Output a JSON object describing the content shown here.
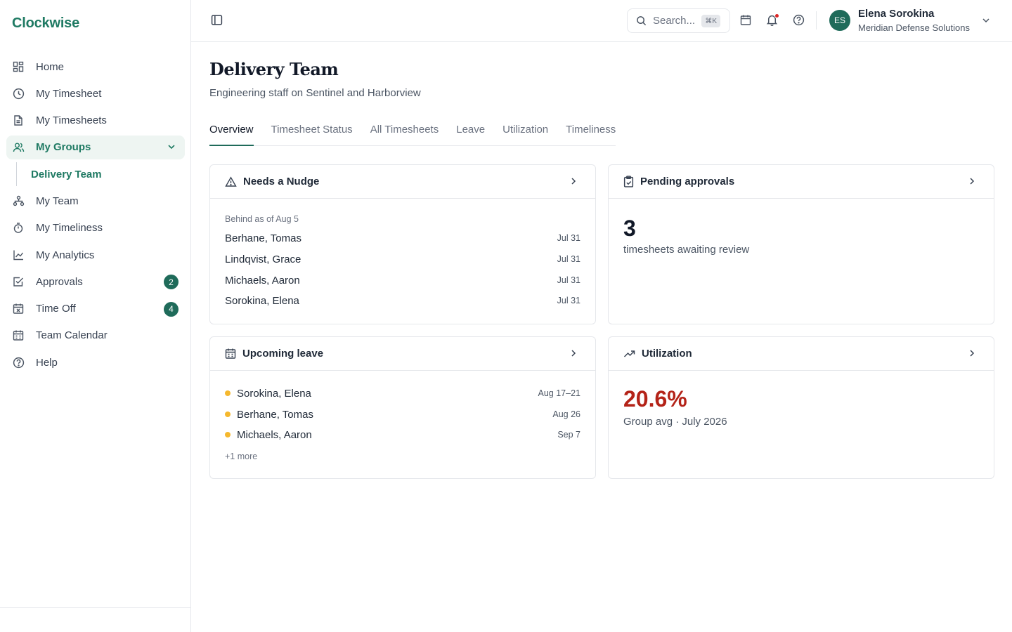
{
  "app": {
    "name": "Clockwise"
  },
  "sidebar": {
    "items": [
      {
        "label": "Home",
        "icon": "grid-icon"
      },
      {
        "label": "My Timesheet",
        "icon": "clock-icon"
      },
      {
        "label": "My Timesheets",
        "icon": "document-icon"
      },
      {
        "label": "My Groups",
        "icon": "users-icon"
      },
      {
        "label": "My Team",
        "icon": "org-chart-icon"
      },
      {
        "label": "My Timeliness",
        "icon": "stopwatch-icon"
      },
      {
        "label": "My Analytics",
        "icon": "line-chart-icon"
      },
      {
        "label": "Approvals",
        "icon": "checkbox-icon",
        "badge": "2"
      },
      {
        "label": "Time Off",
        "icon": "calendar-x-icon",
        "badge": "4"
      },
      {
        "label": "Team Calendar",
        "icon": "calendar-icon"
      },
      {
        "label": "Help",
        "icon": "help-circle-icon"
      }
    ],
    "subitem": {
      "label": "Delivery Team"
    }
  },
  "topbar": {
    "search_placeholder": "Search...",
    "shortcut": "⌘K",
    "user": {
      "initials": "ES",
      "name": "Elena Sorokina",
      "org": "Meridian Defense Solutions"
    }
  },
  "page": {
    "title": "Delivery Team",
    "subtitle": "Engineering staff on Sentinel and Harborview",
    "tabs": [
      "Overview",
      "Timesheet Status",
      "All Timesheets",
      "Leave",
      "Utilization",
      "Timeliness"
    ]
  },
  "cards": {
    "nudge": {
      "title": "Needs a Nudge",
      "caption": "Behind as of Aug 5",
      "rows": [
        {
          "name": "Berhane, Tomas",
          "date": "Jul 31"
        },
        {
          "name": "Lindqvist, Grace",
          "date": "Jul 31"
        },
        {
          "name": "Michaels, Aaron",
          "date": "Jul 31"
        },
        {
          "name": "Sorokina, Elena",
          "date": "Jul 31"
        }
      ]
    },
    "pending": {
      "title": "Pending approvals",
      "value": "3",
      "label": "timesheets awaiting review"
    },
    "leave": {
      "title": "Upcoming leave",
      "rows": [
        {
          "name": "Sorokina, Elena",
          "date": "Aug 17–21"
        },
        {
          "name": "Berhane, Tomas",
          "date": "Aug 26"
        },
        {
          "name": "Michaels, Aaron",
          "date": "Sep 7"
        }
      ],
      "more": "+1 more",
      "dot_color": "#f5b82e"
    },
    "utilization": {
      "title": "Utilization",
      "value": "20.6%",
      "label": "Group avg · July 2026",
      "value_color": "#b42318"
    }
  },
  "colors": {
    "accent": "#1f7a63",
    "badge": "#1f6b5a",
    "notification": "#dc2626"
  }
}
